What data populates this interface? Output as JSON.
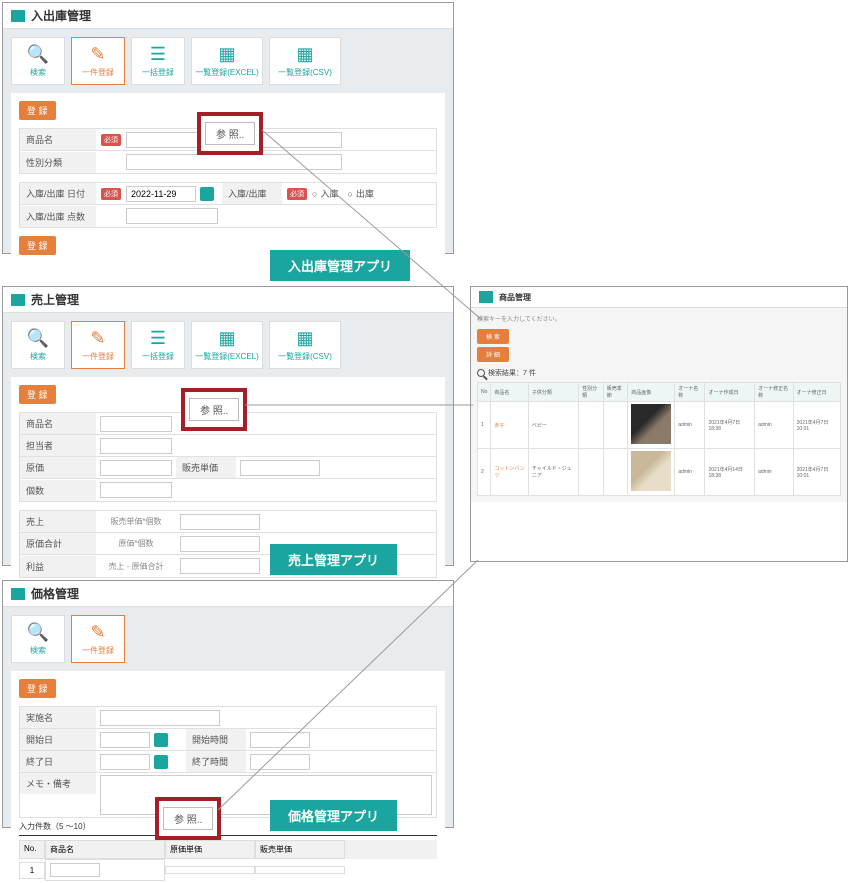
{
  "panel1": {
    "title": "入出庫管理",
    "tabs": {
      "search": "検索",
      "single": "一件登録",
      "bulk": "一括登録",
      "excel": "一覧登録(EXCEL)",
      "csv": "一覧登録(CSV)"
    },
    "register": "登 録",
    "fields": {
      "product": "商品名",
      "required": "必須",
      "category": "性別分類",
      "date": "入庫/出庫 日付",
      "date_val": "2022-11-29",
      "type": "入庫/出庫",
      "in": "入庫",
      "out": "出庫",
      "count": "入庫/出庫 点数"
    },
    "reference": "参 照.."
  },
  "tag1": "入出庫管理アプリ",
  "panel2": {
    "title": "売上管理",
    "tabs": {
      "search": "検索",
      "single": "一件登録",
      "bulk": "一括登録",
      "excel": "一覧登録(EXCEL)",
      "csv": "一覧登録(CSV)"
    },
    "register": "登 録",
    "fields": {
      "product": "商品名",
      "staff": "担当者",
      "cost": "原価",
      "price": "販売単価",
      "qty": "個数",
      "sales": "売上",
      "sales_calc": "販売単価*個数",
      "cost_total": "原価合計",
      "cost_calc": "原価*個数",
      "profit": "利益",
      "profit_calc": "売上 - 原価合計"
    },
    "reference": "参 照.."
  },
  "tag2": "売上管理アプリ",
  "panel3": {
    "title": "価格管理",
    "tabs": {
      "search": "検索",
      "single": "一件登録"
    },
    "register": "登 録",
    "fields": {
      "name": "実施名",
      "start": "開始日",
      "start_time": "開始時間",
      "end": "終了日",
      "end_time": "終了時間",
      "memo": "メモ・備考",
      "count_label": "入力件数（5 ～10）",
      "no": "No.",
      "product": "商品名",
      "cost": "原価単価",
      "price": "販売単価",
      "row1_no": "1"
    },
    "reference": "参 照.."
  },
  "tag3": "価格管理アプリ",
  "mini": {
    "title": "商品管理",
    "prompt": "検索キーを入力してください。",
    "search": "検 索",
    "detail": "詳 細",
    "result": "検索結果：7 件",
    "headers": {
      "no": "No",
      "name": "商品名",
      "cat": "子供分類",
      "cat2": "性別分類",
      "season": "販売季節",
      "img": "商品画像",
      "user": "オーナ名称",
      "cdate": "オーナ作成日",
      "muser": "オーナ修正名称",
      "mdate": "オーナ修正日"
    },
    "rows": [
      {
        "no": "1",
        "name": "赤子",
        "cat": "ベビー",
        "user": "admin",
        "cdate": "2021年4月7日 18:38",
        "muser": "admin",
        "mdate": "2021年4月7日 10:01"
      },
      {
        "no": "2",
        "name": "コットンパンツ",
        "cat": "チャイルド・ジュニア",
        "user": "admin",
        "cdate": "2021年4月14日 18:38",
        "muser": "admin",
        "mdate": "2021年4月7日 10:01"
      }
    ]
  }
}
